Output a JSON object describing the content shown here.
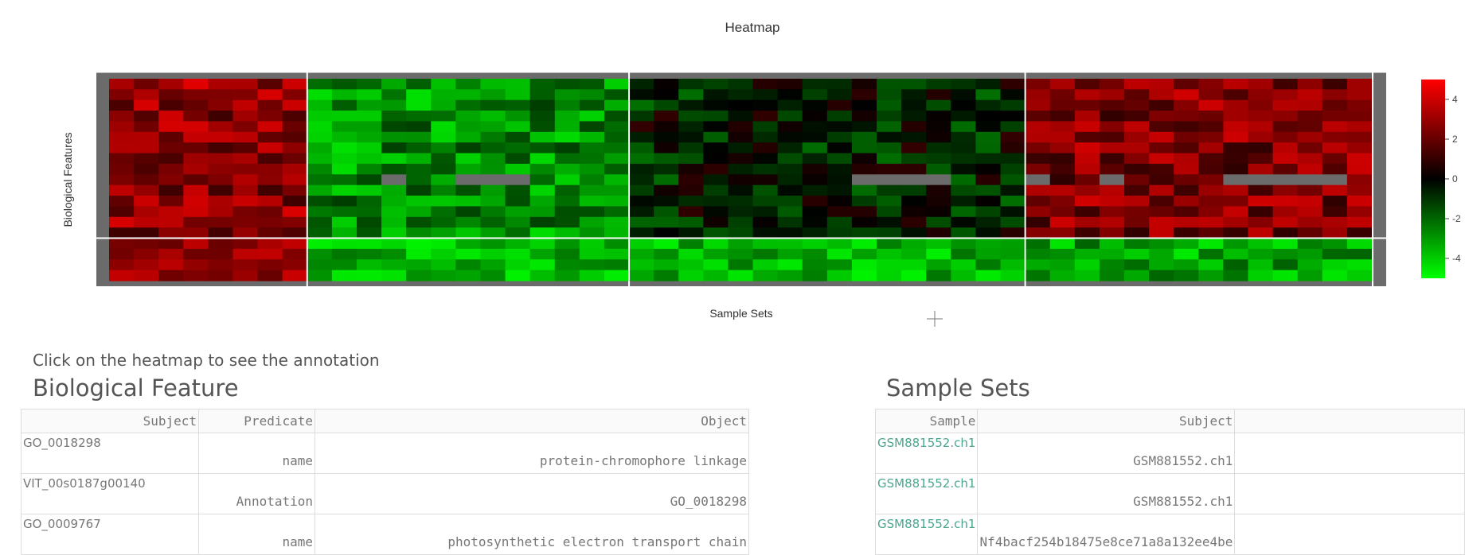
{
  "chart_data": {
    "type": "heatmap",
    "title": "Heatmap",
    "xlabel": "Sample Sets",
    "ylabel": "Biological Features",
    "colorbar": {
      "ticks": [
        4,
        2,
        0,
        -2,
        -4
      ],
      "range": [
        -5,
        5
      ],
      "colors": {
        "high": "#ff0000",
        "mid": "#000000",
        "low": "#00ff00"
      }
    },
    "missing_color": "#6b6b6b",
    "column_groups": [
      {
        "cols": [
          0,
          1,
          2,
          3,
          4,
          5,
          6,
          7
        ],
        "bias": 2.8
      },
      {
        "cols": [
          8,
          9,
          10,
          11,
          12,
          13,
          14,
          15,
          16,
          17,
          18,
          19,
          20
        ],
        "bias": -2.8
      },
      {
        "cols": [
          21,
          22,
          23,
          24,
          25,
          26,
          27,
          28,
          29,
          30,
          31,
          32,
          33,
          34,
          35,
          36
        ],
        "bias": -0.6
      },
      {
        "cols": [
          37,
          38,
          39,
          40,
          41,
          42,
          43,
          44,
          45,
          46,
          47,
          48,
          49,
          50
        ],
        "bias": 2.5
      }
    ],
    "row_groups": [
      {
        "rows": [
          0,
          1,
          2,
          3,
          4,
          5,
          6,
          7,
          8,
          9,
          10,
          11,
          12,
          13,
          14
        ],
        "bias": 0
      },
      {
        "rows": [
          15,
          16,
          17,
          18
        ],
        "bias": -2.5
      }
    ]
  },
  "hint": "Click on the heatmap to see the annotation",
  "bio_feature": {
    "title": "Biological Feature",
    "headers": [
      "Subject",
      "Predicate",
      "Object"
    ],
    "rows": [
      [
        "GO_0018298",
        "name",
        "protein-chromophore linkage"
      ],
      [
        "VIT_00s0187g00140",
        "Annotation",
        "GO_0018298"
      ],
      [
        "GO_0009767",
        "name",
        "photosynthetic electron transport chain"
      ]
    ]
  },
  "sample_sets": {
    "title": "Sample Sets",
    "headers": [
      "Sample",
      "Subject",
      ""
    ],
    "rows": [
      [
        "GSM881552.ch1",
        "GSM881552.ch1"
      ],
      [
        "GSM881552.ch1",
        "GSM881552.ch1"
      ],
      [
        "GSM881552.ch1",
        "Nf4bacf254b18475e8ce71a8a132ee4be"
      ]
    ]
  }
}
